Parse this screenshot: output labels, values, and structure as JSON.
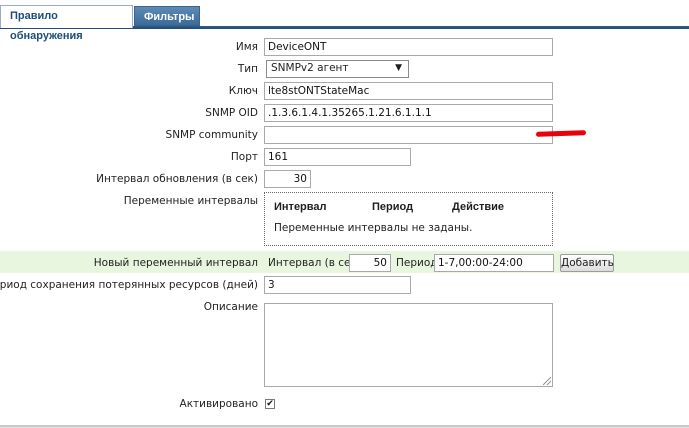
{
  "tabs": [
    {
      "label": "Правило обнаружения",
      "active": true
    },
    {
      "label": "Фильтры",
      "active": false
    }
  ],
  "form": {
    "name": {
      "label": "Имя",
      "value": "DeviceONT"
    },
    "type": {
      "label": "Тип",
      "value": "SNMPv2 агент"
    },
    "key": {
      "label": "Ключ",
      "value": "lte8stONTStateMac"
    },
    "snmp_oid": {
      "label": "SNMP OID",
      "value": ".1.3.6.1.4.1.35265.1.21.6.1.1.1"
    },
    "snmp_community": {
      "label": "SNMP community",
      "value": ""
    },
    "port": {
      "label": "Порт",
      "value": "161"
    },
    "interval": {
      "label": "Интервал обновления (в сек)",
      "value": "30"
    },
    "flex": {
      "label": "Переменные интервалы",
      "columns": [
        "Интервал",
        "Период",
        "Действие"
      ],
      "empty_text": "Переменные интервалы не заданы."
    },
    "new_flex": {
      "label": "Новый переменный интервал",
      "interval_label": "Интервал (в сек)",
      "interval_value": "50",
      "period_label": "Период",
      "period_value": "1-7,00:00-24:00",
      "add_button": "Добавить"
    },
    "lifetime": {
      "label": "Период сохранения потерянных ресурсов (дней)",
      "value": "3"
    },
    "description": {
      "label": "Описание",
      "value": ""
    },
    "status": {
      "label": "Активировано",
      "checked": true
    }
  },
  "colors": {
    "tab_active_text": "#1e4d7b",
    "tab_bar": "#2d5d8a",
    "highlight_row": "#e8f5df",
    "redaction": "#e8000b"
  }
}
